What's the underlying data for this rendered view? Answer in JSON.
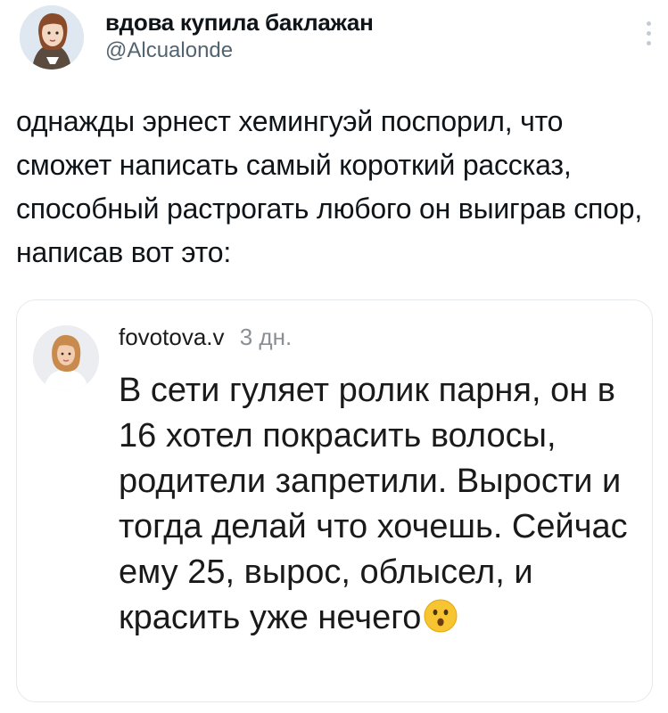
{
  "tweet": {
    "author_name": "вдова купила баклажан",
    "author_handle": "@Alcualonde",
    "text": "однажды эрнест хемингуэй поспорил, что сможет написать самый короткий рассказ, способный растрогать любого он выиграв спор, написав вот это:"
  },
  "quote": {
    "username": "fovotova.v",
    "time": "3 дн.",
    "text": "В сети гуляет ролик парня, он в 16 хотел покрасить волосы, родители запретили. Вырости и тогда делай что хочешь. Сейчас ему 25, вырос, облысел, и красить уже нечего",
    "emoji": "hushed-face-emoji"
  },
  "icons": {
    "more": "more-vertical-icon",
    "author_avatar": "avatar",
    "quote_avatar": "avatar"
  }
}
